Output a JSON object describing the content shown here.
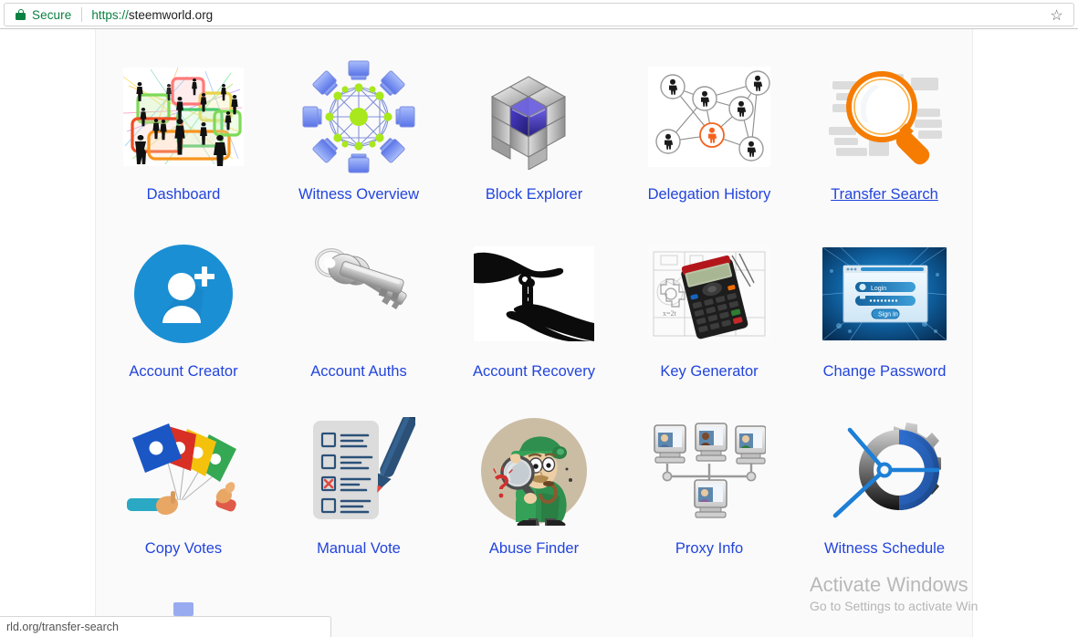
{
  "browser": {
    "security_label": "Secure",
    "url_scheme": "https://",
    "url_host": "steemworld.org",
    "lock_icon": "lock-icon",
    "star_icon": "star-icon",
    "status_bar_text": "rld.org/transfer-search"
  },
  "colors": {
    "link": "#2244dd",
    "secure_green": "#0b8043",
    "page_bg": "#fafafa",
    "accent_orange": "#f57c00",
    "accent_blue": "#1b8fd4"
  },
  "watermark": {
    "title": "Activate Windows",
    "subtitle": "Go to Settings to activate Win"
  },
  "grid": {
    "tiles": [
      {
        "label": "Dashboard",
        "icon": "dashboard-network-icon",
        "hovered": false
      },
      {
        "label": "Witness Overview",
        "icon": "witness-network-icon",
        "hovered": false
      },
      {
        "label": "Block Explorer",
        "icon": "block-cube-icon",
        "hovered": false
      },
      {
        "label": "Delegation History",
        "icon": "delegation-graph-icon",
        "hovered": false
      },
      {
        "label": "Transfer Search",
        "icon": "magnifier-search-icon",
        "hovered": true
      },
      {
        "label": "Account Creator",
        "icon": "add-user-icon",
        "hovered": false
      },
      {
        "label": "Account Auths",
        "icon": "keys-icon",
        "hovered": false
      },
      {
        "label": "Account Recovery",
        "icon": "hands-key-handover-icon",
        "hovered": false
      },
      {
        "label": "Key Generator",
        "icon": "calculator-blueprint-icon",
        "hovered": false
      },
      {
        "label": "Change Password",
        "icon": "login-dialog-icon",
        "hovered": false
      },
      {
        "label": "Copy Votes",
        "icon": "colored-cards-hand-icon",
        "hovered": false
      },
      {
        "label": "Manual Vote",
        "icon": "ballot-checklist-pen-icon",
        "hovered": false
      },
      {
        "label": "Abuse Finder",
        "icon": "detective-icon",
        "hovered": false
      },
      {
        "label": "Proxy Info",
        "icon": "computers-network-icon",
        "hovered": false
      },
      {
        "label": "Witness Schedule",
        "icon": "gear-clock-icon",
        "hovered": false
      }
    ],
    "partial_row_icon": "partial-network-icon"
  }
}
